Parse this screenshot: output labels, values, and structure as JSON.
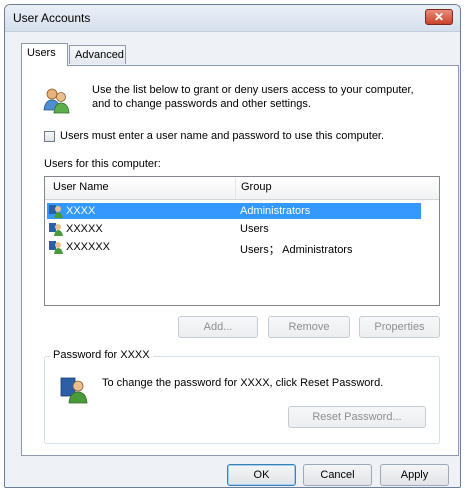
{
  "window": {
    "title": "User Accounts",
    "close_glyph": "✕"
  },
  "tabs": [
    {
      "label": "Users"
    },
    {
      "label": "Advanced"
    }
  ],
  "intro": {
    "line1": "Use the list below to grant or deny users access to your computer,",
    "line2": "and to change passwords and other settings.",
    "icon": "users-icon"
  },
  "require_login": {
    "label": "Users must enter a user name and password to use this computer.",
    "checked": false
  },
  "users_section_label": "Users for this computer:",
  "list": {
    "columns": [
      "User Name",
      "Group"
    ],
    "rows": [
      {
        "name": "XXXX",
        "group": "Administrators",
        "selected": true
      },
      {
        "name": "XXXXX",
        "group": "Users",
        "selected": false
      },
      {
        "name": "XXXXXX",
        "group": "Users； Administrators",
        "selected": false
      }
    ]
  },
  "list_buttons": {
    "add": "Add...",
    "remove": "Remove",
    "properties": "Properties"
  },
  "password_group": {
    "title": "Password for XXXX",
    "text": "To change the password for XXXX, click Reset Password.",
    "reset_button": "Reset Password...",
    "icon": "user-key-icon"
  },
  "dialog_buttons": {
    "ok": "OK",
    "cancel": "Cancel",
    "apply": "Apply"
  },
  "colors": {
    "selection": "#3399ff",
    "close_button": "#c8432b",
    "window_bg": "#eef2f7"
  }
}
